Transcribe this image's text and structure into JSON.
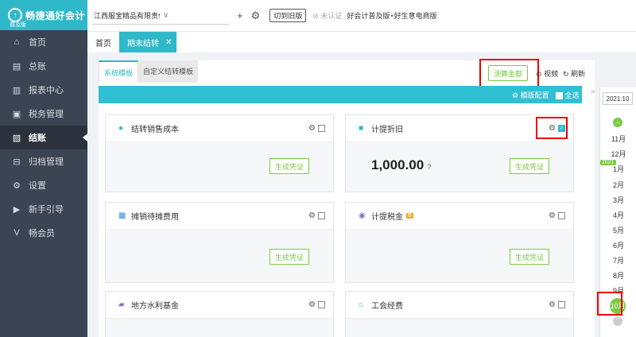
{
  "app": {
    "logo_text": "畅捷通好会计",
    "logo_badge": "普及版"
  },
  "sidebar": {
    "items": [
      {
        "label": "首页",
        "icon": "home-icon",
        "glyph": "⌂"
      },
      {
        "label": "总账",
        "icon": "ledger-icon",
        "glyph": "▤"
      },
      {
        "label": "报表中心",
        "icon": "report-icon",
        "glyph": "▥"
      },
      {
        "label": "税务管理",
        "icon": "tax-icon",
        "glyph": "▣"
      },
      {
        "label": "结账",
        "icon": "checkout-icon",
        "glyph": "▧"
      },
      {
        "label": "归档管理",
        "icon": "archive-icon",
        "glyph": "⊟"
      },
      {
        "label": "设置",
        "icon": "gear-icon",
        "glyph": "⚙"
      },
      {
        "label": "新手引导",
        "icon": "guide-icon",
        "glyph": "▶"
      },
      {
        "label": "畅会员",
        "icon": "member-icon",
        "glyph": "V"
      }
    ]
  },
  "topbar": {
    "company": "江西服宝精品有限责任公司（L）勿删...",
    "switch_label": "切到旧版",
    "auth_label": "未认证",
    "promo": "好会计普及版+好生意电商版"
  },
  "tabs": {
    "home": "首页",
    "active": "期末结转"
  },
  "subtabs": {
    "system": "系统模板",
    "custom": "自定义结转模板"
  },
  "actions": {
    "calc": "测算金额",
    "view": "视频",
    "refresh": "刷新"
  },
  "toolbar": {
    "config": "模版配置",
    "select_all": "全选"
  },
  "cards": [
    {
      "title": "结转销售成本",
      "btn": "生成凭证"
    },
    {
      "title": "计提折旧",
      "btn": "生成凭证",
      "amount": "1,000.00"
    },
    {
      "title": "摊销待摊费用",
      "btn": "生成凭证"
    },
    {
      "title": "计提税金",
      "btn": "生成凭证",
      "tag": "B"
    },
    {
      "title": "地方水利基金"
    },
    {
      "title": "工会经费"
    }
  ],
  "periods": {
    "year_value": "2021.10",
    "year_badge": "2021",
    "months": [
      "11月",
      "12月",
      "1月",
      "2月",
      "3月",
      "4月",
      "5月",
      "6月",
      "7月",
      "8月",
      "9月",
      "10月"
    ]
  },
  "colors": {
    "accent": "#2fb8c9",
    "green": "#7ac943",
    "sidebar": "#3b4452"
  }
}
